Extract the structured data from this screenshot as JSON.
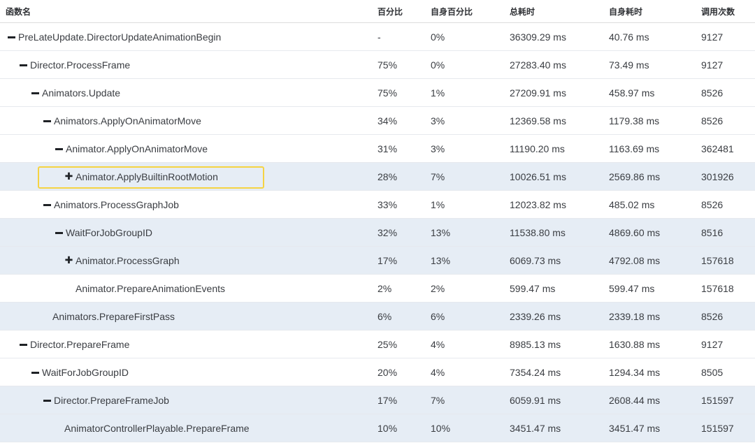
{
  "columns": {
    "name": "函数名",
    "pct": "百分比",
    "self_pct": "自身百分比",
    "total_time": "总耗时",
    "self_time": "自身耗时",
    "calls": "调用次数"
  },
  "rows": [
    {
      "name": "PreLateUpdate.DirectorUpdateAnimationBegin",
      "pct": "-",
      "self_pct": "0%",
      "total": "36309.29 ms",
      "self": "40.76 ms",
      "calls": "9127"
    },
    {
      "name": "Director.ProcessFrame",
      "pct": "75%",
      "self_pct": "0%",
      "total": "27283.40 ms",
      "self": "73.49 ms",
      "calls": "9127"
    },
    {
      "name": "Animators.Update",
      "pct": "75%",
      "self_pct": "1%",
      "total": "27209.91 ms",
      "self": "458.97 ms",
      "calls": "8526"
    },
    {
      "name": "Animators.ApplyOnAnimatorMove",
      "pct": "34%",
      "self_pct": "3%",
      "total": "12369.58 ms",
      "self": "1179.38 ms",
      "calls": "8526"
    },
    {
      "name": "Animator.ApplyOnAnimatorMove",
      "pct": "31%",
      "self_pct": "3%",
      "total": "11190.20 ms",
      "self": "1163.69 ms",
      "calls": "362481"
    },
    {
      "name": "Animator.ApplyBuiltinRootMotion",
      "pct": "28%",
      "self_pct": "7%",
      "total": "10026.51 ms",
      "self": "2569.86 ms",
      "calls": "301926"
    },
    {
      "name": "Animators.ProcessGraphJob",
      "pct": "33%",
      "self_pct": "1%",
      "total": "12023.82 ms",
      "self": "485.02 ms",
      "calls": "8526"
    },
    {
      "name": "WaitForJobGroupID",
      "pct": "32%",
      "self_pct": "13%",
      "total": "11538.80 ms",
      "self": "4869.60 ms",
      "calls": "8516"
    },
    {
      "name": "Animator.ProcessGraph",
      "pct": "17%",
      "self_pct": "13%",
      "total": "6069.73 ms",
      "self": "4792.08 ms",
      "calls": "157618"
    },
    {
      "name": "Animator.PrepareAnimationEvents",
      "pct": "2%",
      "self_pct": "2%",
      "total": "599.47 ms",
      "self": "599.47 ms",
      "calls": "157618"
    },
    {
      "name": "Animators.PrepareFirstPass",
      "pct": "6%",
      "self_pct": "6%",
      "total": "2339.26 ms",
      "self": "2339.18 ms",
      "calls": "8526"
    },
    {
      "name": "Director.PrepareFrame",
      "pct": "25%",
      "self_pct": "4%",
      "total": "8985.13 ms",
      "self": "1630.88 ms",
      "calls": "9127"
    },
    {
      "name": "WaitForJobGroupID",
      "pct": "20%",
      "self_pct": "4%",
      "total": "7354.24 ms",
      "self": "1294.34 ms",
      "calls": "8505"
    },
    {
      "name": "Director.PrepareFrameJob",
      "pct": "17%",
      "self_pct": "7%",
      "total": "6059.91 ms",
      "self": "2608.44 ms",
      "calls": "151597"
    },
    {
      "name": "AnimatorControllerPlayable.PrepareFrame",
      "pct": "10%",
      "self_pct": "10%",
      "total": "3451.47 ms",
      "self": "3451.47 ms",
      "calls": "151597"
    }
  ]
}
